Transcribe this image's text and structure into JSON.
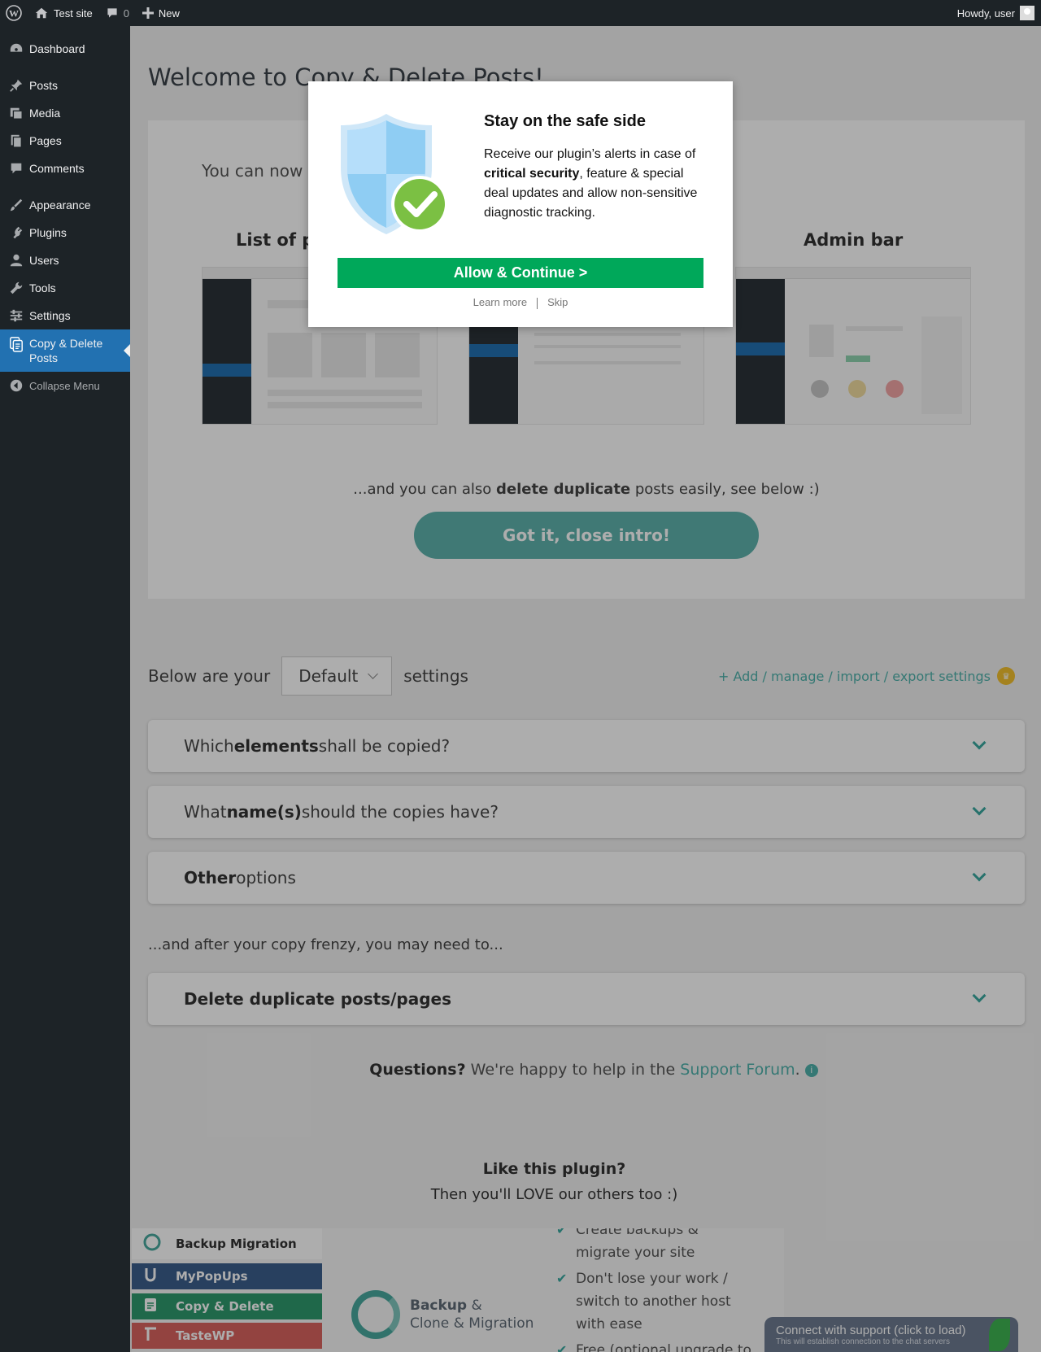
{
  "adminbar": {
    "site_name": "Test site",
    "comments_count": "0",
    "new_label": "New",
    "howdy": "Howdy, user"
  },
  "sidebar": {
    "items": [
      {
        "label": "Dashboard",
        "icon": "dashboard-icon"
      },
      {
        "label": "Posts",
        "icon": "pin-icon"
      },
      {
        "label": "Media",
        "icon": "media-icon"
      },
      {
        "label": "Pages",
        "icon": "pages-icon"
      },
      {
        "label": "Comments",
        "icon": "comment-icon"
      },
      {
        "label": "Appearance",
        "icon": "brush-icon"
      },
      {
        "label": "Plugins",
        "icon": "plug-icon"
      },
      {
        "label": "Users",
        "icon": "user-icon"
      },
      {
        "label": "Tools",
        "icon": "wrench-icon"
      },
      {
        "label": "Settings",
        "icon": "sliders-icon"
      },
      {
        "label": "Copy & Delete Posts",
        "icon": "copy-icon"
      }
    ],
    "collapse_label": "Collapse Menu"
  },
  "main": {
    "welcome_title": "Welcome to Copy & Delete Posts!",
    "intro_text": "You can now",
    "columns": [
      "List of p",
      "Admin bar"
    ],
    "also_prefix": "...and you can also ",
    "also_bold": "delete duplicate",
    "also_suffix": " posts easily, see below :)",
    "close_intro_button": "Got it, close intro!",
    "settings_prefix": "Below are your",
    "settings_select": "Default",
    "settings_suffix": "settings",
    "manage_link": "+ Add / manage / import / export settings",
    "panels": [
      {
        "pre": "Which ",
        "bold": "elements",
        "post": " shall be copied?"
      },
      {
        "pre": "What ",
        "bold": "name(s)",
        "post": " should the copies have?"
      },
      {
        "pre": "",
        "bold": "Other",
        "post": " options"
      }
    ],
    "after_text": "...and after your copy frenzy, you may need to...",
    "delete_panel": "Delete duplicate posts/pages",
    "questions_bold": "Questions?",
    "questions_text": " We're happy to help in the ",
    "support_link": "Support Forum",
    "questions_end": ".",
    "like_title": "Like this plugin?",
    "like_sub": "Then you'll LOVE our others too :)",
    "plugins": [
      {
        "name": "Backup Migration",
        "color": "#ffffff"
      },
      {
        "name": "MyPopUps",
        "color": "#3b5f8c"
      },
      {
        "name": "Copy & Delete",
        "color": "#2f9a6d"
      },
      {
        "name": "TasteWP",
        "color": "#d9635f"
      }
    ],
    "backup_logo_bold": "Backup",
    "backup_logo_amp": " &",
    "backup_logo_line2": "Clone & Migration",
    "features": [
      "Create backups & migrate your site",
      "Don't lose your work / switch to another host with ease",
      "Free (optional upgrade to"
    ],
    "support_bubble_title": "Connect with support (click to load)",
    "support_bubble_sub": "This will establish connection to the chat servers"
  },
  "modal": {
    "title": "Stay on the safe side",
    "body_pre": "Receive our plugin’s alerts in case of ",
    "body_bold": "critical security",
    "body_post": ", feature & special deal updates and allow non-sensitive diagnostic tracking.",
    "allow_button": "Allow & Continue >",
    "learn_more": "Learn more",
    "skip": "Skip"
  },
  "colors": {
    "admin_bg": "#1d2327",
    "active_menu": "#2271b1",
    "teal": "#4fb2ab",
    "allow_green": "#00a85a"
  }
}
